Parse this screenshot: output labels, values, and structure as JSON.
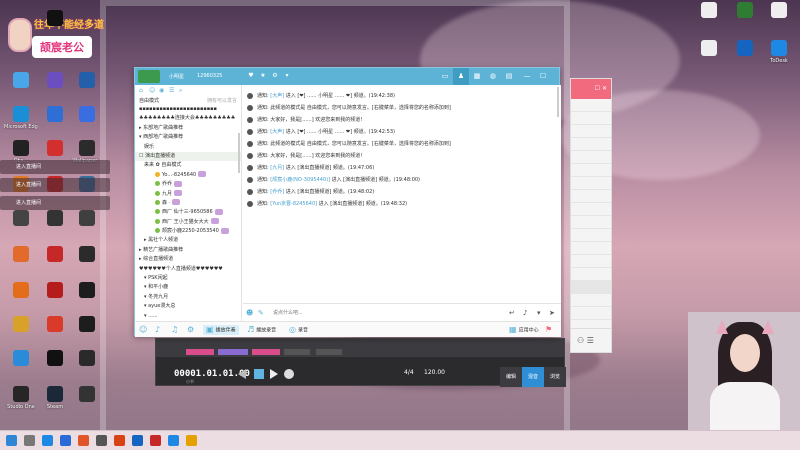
{
  "banner": {
    "line1": "往年不能经多道",
    "line2": "颉宸老公"
  },
  "desktop_icons": [
    {
      "label": "",
      "color": "#3d7fd6"
    },
    {
      "label": "",
      "color": "#1c82e8"
    },
    {
      "label": "",
      "color": "#1e2a3a"
    },
    {
      "label": "",
      "color": "#49a6e8"
    },
    {
      "label": "",
      "color": "#6b4fc1"
    },
    {
      "label": "",
      "color": "#245fa9"
    },
    {
      "label": "Microsoft Edge",
      "color": "#1b8fd6"
    },
    {
      "label": "",
      "color": "#2d6fd4"
    },
    {
      "label": "",
      "color": "#3a6ee0"
    },
    {
      "label": "Obs...",
      "color": "#222"
    },
    {
      "label": "",
      "color": "#d32f2f"
    },
    {
      "label": "Wallpaper...",
      "color": "#2b2b2b"
    },
    {
      "label": "",
      "color": "#e07a28"
    },
    {
      "label": "",
      "color": "#c62828"
    },
    {
      "label": "",
      "color": "#3a6e9a"
    },
    {
      "label": "",
      "color": "#444"
    },
    {
      "label": "",
      "color": "#333"
    },
    {
      "label": "",
      "color": "#3f3f3f"
    },
    {
      "label": "",
      "color": "#e26b2c"
    },
    {
      "label": "",
      "color": "#c62828"
    },
    {
      "label": "",
      "color": "#2b2b2b"
    },
    {
      "label": "",
      "color": "#e36d1c"
    },
    {
      "label": "",
      "color": "#b71c1c"
    },
    {
      "label": "",
      "color": "#1d1d1d"
    },
    {
      "label": "",
      "color": "#d8a12a"
    },
    {
      "label": "",
      "color": "#d93a2a"
    },
    {
      "label": "",
      "color": "#1d1d1d"
    },
    {
      "label": "",
      "color": "#2a8bd8"
    },
    {
      "label": "",
      "color": "#111"
    },
    {
      "label": "",
      "color": "#2a2a2a"
    },
    {
      "label": "Studio One",
      "color": "#262626"
    },
    {
      "label": "Steam",
      "color": "#1b2838"
    },
    {
      "label": "",
      "color": "#333"
    },
    {
      "label": "",
      "color": "#111"
    }
  ],
  "right_icons": [
    {
      "label": "",
      "color": "#eee"
    },
    {
      "label": "",
      "color": "#2e7d32"
    },
    {
      "label": "",
      "color": "#eee"
    },
    {
      "label": "",
      "color": "#eee"
    },
    {
      "label": "",
      "color": "#1565c0"
    },
    {
      "label": "ToDesk",
      "color": "#1e88e5"
    }
  ],
  "toasts": [
    "进入直播间",
    "进入直播间",
    "进入直播间"
  ],
  "daw": {
    "timecode": "00001.01.01.00",
    "tc_label": "小节",
    "buttons": [
      "编辑",
      "混音",
      "浏览"
    ],
    "sig": "4/4",
    "tempo": "120.00"
  },
  "side_panel": {
    "header": "☐ ✕",
    "rows": [
      "",
      "",
      "",
      "",
      "",
      "",
      "",
      "",
      "",
      "",
      "",
      "",
      "",
      "",
      "",
      "",
      ""
    ],
    "highlight_index": 14
  },
  "app": {
    "title": "小明星",
    "id": "12960325",
    "sidebar": {
      "header_left": "自由模式",
      "header_right": "拥有可以发言",
      "items": [
        {
          "text": "▪▪▪▪▪▪▪▪▪▪▪▪▪▪▪▪▪▪▪▪▪▪▪",
          "lvl": 0
        },
        {
          "text": "♣♣♣♣♣♣♣♣连接大会♣♣♣♣♣♣♣♣♣",
          "lvl": 0
        },
        {
          "text": "▸ 东部地广歌曲推荐",
          "lvl": 0
        },
        {
          "text": "▾ 西部地广歌曲推荐",
          "lvl": 0
        },
        {
          "text": "娱乐",
          "lvl": 1
        },
        {
          "text": "☐ 演出直播频道",
          "lvl": 0,
          "sel": true
        },
        {
          "text": "来来 ✿ 自由模式",
          "lvl": 1
        },
        {
          "text": "Yo...-8245640",
          "lvl": 2
        },
        {
          "text": "乔乔",
          "lvl": 2
        },
        {
          "text": "九月",
          "lvl": 2
        },
        {
          "text": "森 ·",
          "lvl": 2
        },
        {
          "text": "西厂 仙十三-9650586",
          "lvl": 2
        },
        {
          "text": "西厂 王小王猫女大大",
          "lvl": 2
        },
        {
          "text": "颉宸小鹿2250-2053540",
          "lvl": 2
        },
        {
          "text": "▸ 黑社个人频道",
          "lvl": 1
        },
        {
          "text": "▸ 精艺广播歌曲推荐",
          "lvl": 0
        },
        {
          "text": "▸ 综合直播频道",
          "lvl": 0
        },
        {
          "text": "♥♥♥♥♥♥个人直播频道♥♥♥♥♥♥",
          "lvl": 0
        },
        {
          "text": "▾ PSK闲起",
          "lvl": 1
        },
        {
          "text": "▾ 和平小鹿",
          "lvl": 1
        },
        {
          "text": "▾ 冬尧九月",
          "lvl": 1
        },
        {
          "text": "▾ ayue漫大总",
          "lvl": 1
        },
        {
          "text": "▾ ......",
          "lvl": 1
        }
      ]
    },
    "messages": [
      {
        "tag": "通知:",
        "who": "[大声]",
        "rest": "进入 [❤] ...... 小明星 ...... ❤] 频道。(19:42:38)"
      },
      {
        "tag": "通知:",
        "who": "",
        "rest": "此频道的模式是 自由模式，您可以随意发言。[右键菜单，选择将您的名称添加到]"
      },
      {
        "tag": "通知:",
        "who": "",
        "rest": "大家好，我是[......] 欢迎您来到我的频道!"
      },
      {
        "tag": "通知:",
        "who": "[大声]",
        "rest": "进入 [❤] ...... 小明星 ...... ❤] 频道。(19:42:53)"
      },
      {
        "tag": "通知:",
        "who": "",
        "rest": "此频道的模式是 自由模式，您可以随意发言。[右键菜单，选择将您的名称添加到]"
      },
      {
        "tag": "通知:",
        "who": "",
        "rest": "大家好，我是[......] 欢迎您来到我的频道!"
      },
      {
        "tag": "通知:",
        "who": "[九月]",
        "rest": "进入 [演出直播频道] 频道。(19:47:06)"
      },
      {
        "tag": "通知:",
        "who": "[颉宸小鹿(NO-3095440)]",
        "rest": "进入 [演出直播频道] 频道。(19:48:00)"
      },
      {
        "tag": "通知:",
        "who": "[乔乔]",
        "rest": "进入 [演出直播频道] 频道。(19:48:02)"
      },
      {
        "tag": "通知:",
        "who": "[Yun京晋-8245640]",
        "rest": "进入 [演出直播频道] 频道。(19:48:32)"
      }
    ],
    "input_placeholder": "说点什么吧...",
    "bottom": {
      "item1": "播放伴奏",
      "item2": "播放录音",
      "item3": "录音",
      "item4": "应用中心"
    }
  },
  "taskbar": [
    {
      "color": "#2f86d6"
    },
    {
      "color": "#777"
    },
    {
      "color": "#1e88e5"
    },
    {
      "color": "#2b6bd8"
    },
    {
      "color": "#e0552a"
    },
    {
      "color": "#555"
    },
    {
      "color": "#d84315"
    },
    {
      "color": "#1565c0"
    },
    {
      "color": "#c62828"
    },
    {
      "color": "#1e88e5"
    },
    {
      "color": "#e5a100"
    }
  ]
}
